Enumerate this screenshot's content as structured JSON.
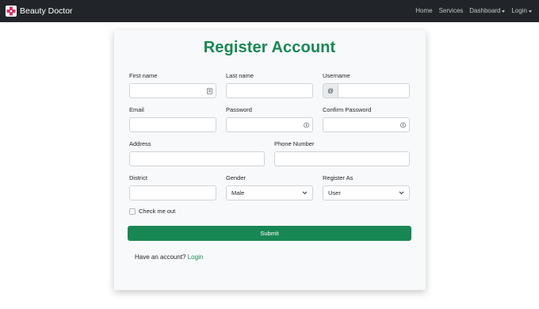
{
  "navbar": {
    "brand": "Beauty Doctor",
    "items": [
      "Home",
      "Services",
      "Dashboard",
      "Login"
    ]
  },
  "form": {
    "title": "Register Account",
    "first_name_label": "First name",
    "last_name_label": "Last name",
    "username_label": "Username",
    "username_addon": "@",
    "email_label": "Email",
    "password_label": "Password",
    "confirm_password_label": "Confirm Password",
    "address_label": "Address",
    "phone_label": "Phone Number",
    "district_label": "District",
    "gender_label": "Gender",
    "gender_value": "Male",
    "register_as_label": "Register As",
    "register_as_value": "User",
    "check_label": "Check me out",
    "submit_label": "Submit",
    "have_account_text": "Have an account?",
    "login_link": "Login"
  },
  "colors": {
    "navbar_bg": "#212529",
    "accent": "#198754",
    "card_bg": "#f8f9fa"
  },
  "icons": [
    "logo-icon",
    "contact-card-icon",
    "key-icon",
    "chevron-down-icon"
  ]
}
